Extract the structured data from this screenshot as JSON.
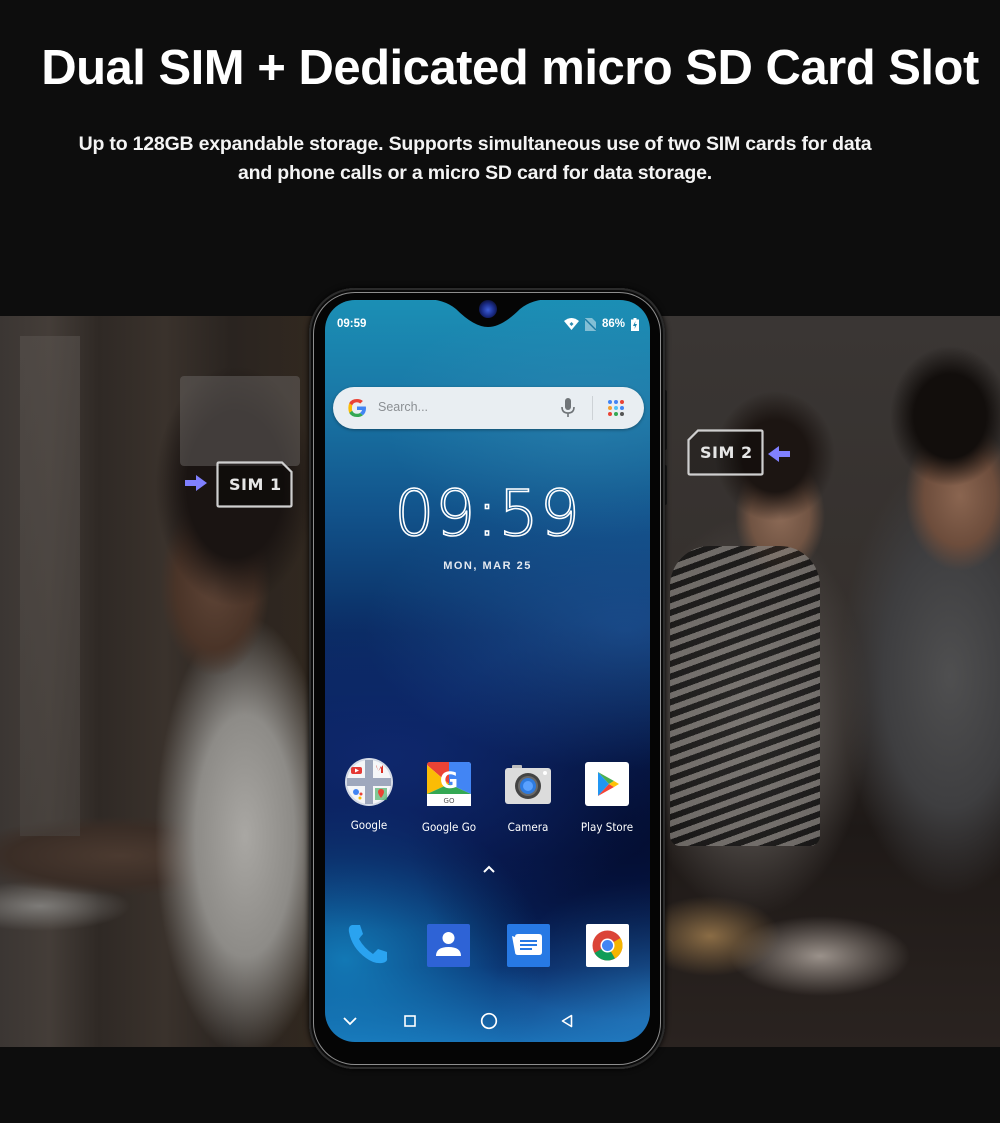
{
  "headline": "Dual SIM + Dedicated micro SD Card Slot",
  "subtitle": {
    "line1": "Up to 128GB expandable storage. Supports simultaneous use of two SIM cards for data",
    "line2": "and phone calls or a micro SD card for data storage."
  },
  "sim_tags": [
    {
      "label": "SIM  1",
      "arrow": "arrow-right-icon",
      "arrow_color": "#8080ff"
    },
    {
      "label": "SIM  2",
      "arrow": "arrow-left-icon",
      "arrow_color": "#8080ff"
    }
  ],
  "phone": {
    "status_bar": {
      "time": "09:59",
      "icons": [
        "wifi-icon",
        "no-sim-icon",
        "battery-charging-icon"
      ],
      "battery_percent": "86%"
    },
    "search": {
      "placeholder": "Search...",
      "icons": [
        "google-g-icon",
        "mic-icon",
        "apps-grid-icon"
      ]
    },
    "clock": {
      "time": "09:59",
      "date": "MON, MAR 25"
    },
    "apps": [
      {
        "label": "Google",
        "icon": "google-folder-icon"
      },
      {
        "label": "Google Go",
        "icon": "google-go-icon"
      },
      {
        "label": "Camera",
        "icon": "camera-icon"
      },
      {
        "label": "Play Store",
        "icon": "play-store-icon"
      }
    ],
    "dock": [
      {
        "name": "Phone",
        "icon": "phone-icon"
      },
      {
        "name": "Contacts",
        "icon": "contacts-icon"
      },
      {
        "name": "Messages",
        "icon": "messages-icon"
      },
      {
        "name": "Chrome",
        "icon": "chrome-icon"
      }
    ],
    "nav": [
      "chevron-down-icon",
      "recents-icon",
      "home-icon",
      "back-icon"
    ]
  },
  "colors": {
    "background": "#0d0d0d",
    "text": "#ffffff",
    "accent_arrow": "#8080ff"
  }
}
